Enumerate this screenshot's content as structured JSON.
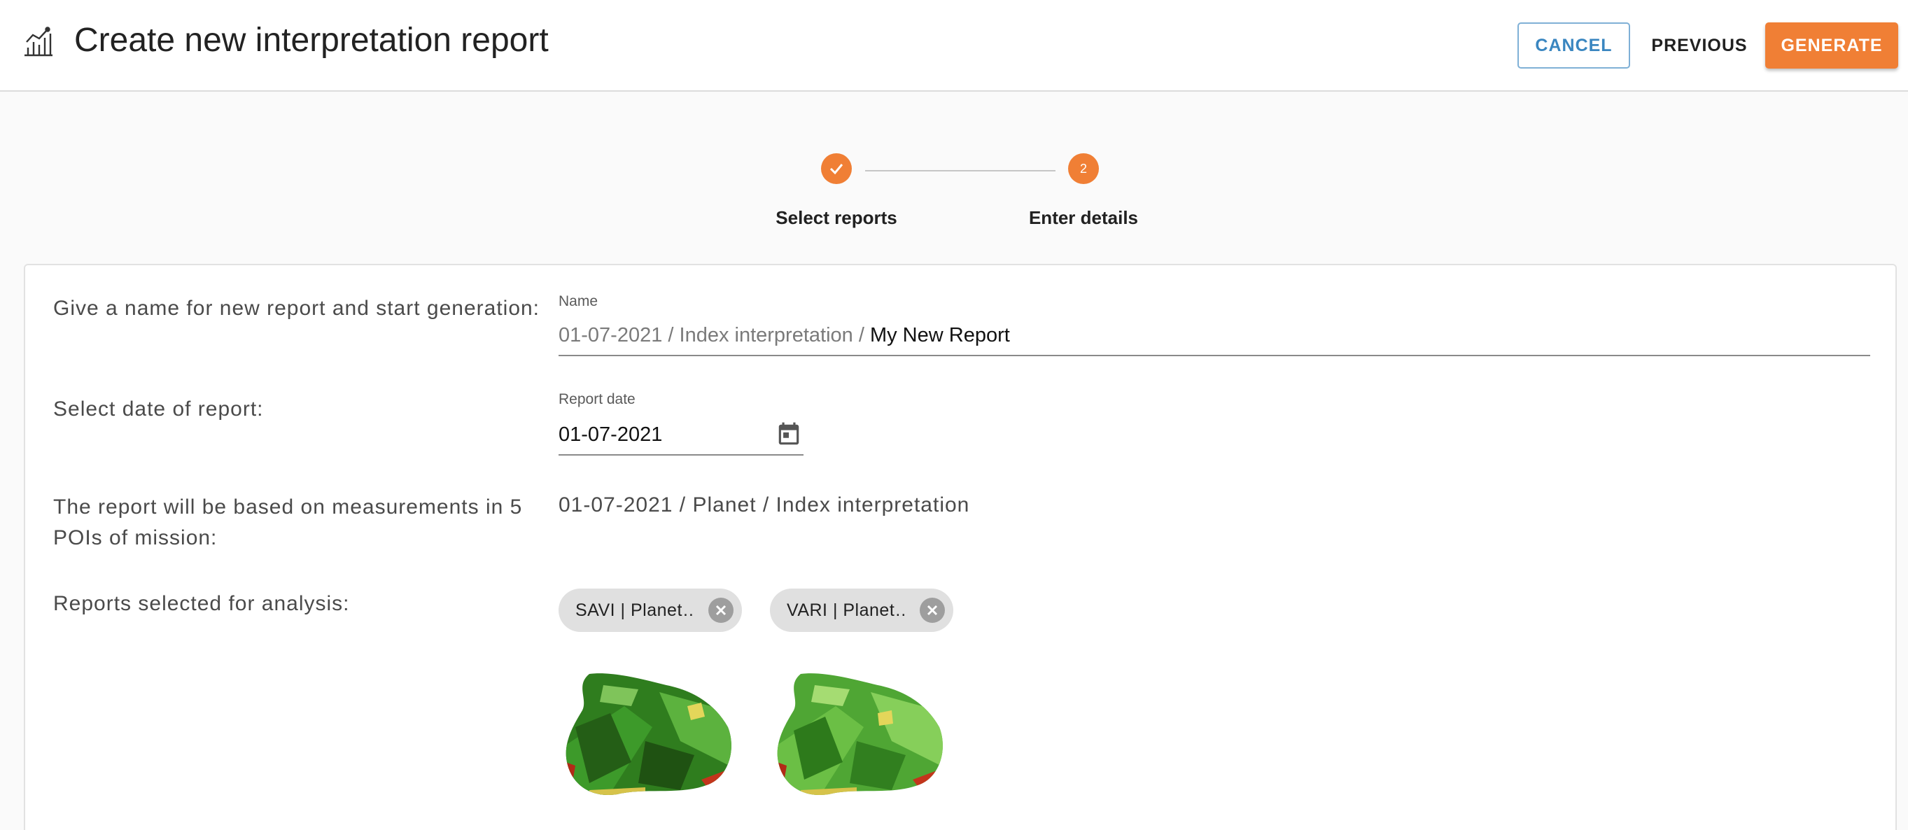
{
  "header": {
    "title": "Create new interpretation report",
    "cancel_label": "CANCEL",
    "previous_label": "PREVIOUS",
    "generate_label": "GENERATE",
    "icon": "chart-icon"
  },
  "stepper": {
    "steps": [
      {
        "label": "Select reports",
        "state": "completed",
        "icon": "check-icon"
      },
      {
        "label": "Enter details",
        "state": "active",
        "number": "2"
      }
    ]
  },
  "form": {
    "name_row_label": "Give a name for new report and start generation:",
    "name_caption": "Name",
    "name_prefix": "01-07-2021 / Index interpretation / ",
    "name_value": "My New Report",
    "date_row_label": "Select date of report:",
    "date_caption": "Report date",
    "date_value": "01-07-2021",
    "date_icon": "calendar-icon",
    "poi_row_label": "The report will be based on measurements in 5 POIs of mission:",
    "poi_value": "01-07-2021 / Planet / Index interpretation",
    "selected_row_label": "Reports selected for analysis:",
    "selected_reports": [
      {
        "label": "SAVI | Planet…",
        "close_icon": "close-circle-icon"
      },
      {
        "label": "VARI | Planet…",
        "close_icon": "close-circle-icon"
      }
    ]
  },
  "colors": {
    "accent": "#f07f35",
    "cancel_border": "#7fb0d6",
    "cancel_text": "#3a86c0",
    "chip_bg": "#e0e0e0"
  }
}
